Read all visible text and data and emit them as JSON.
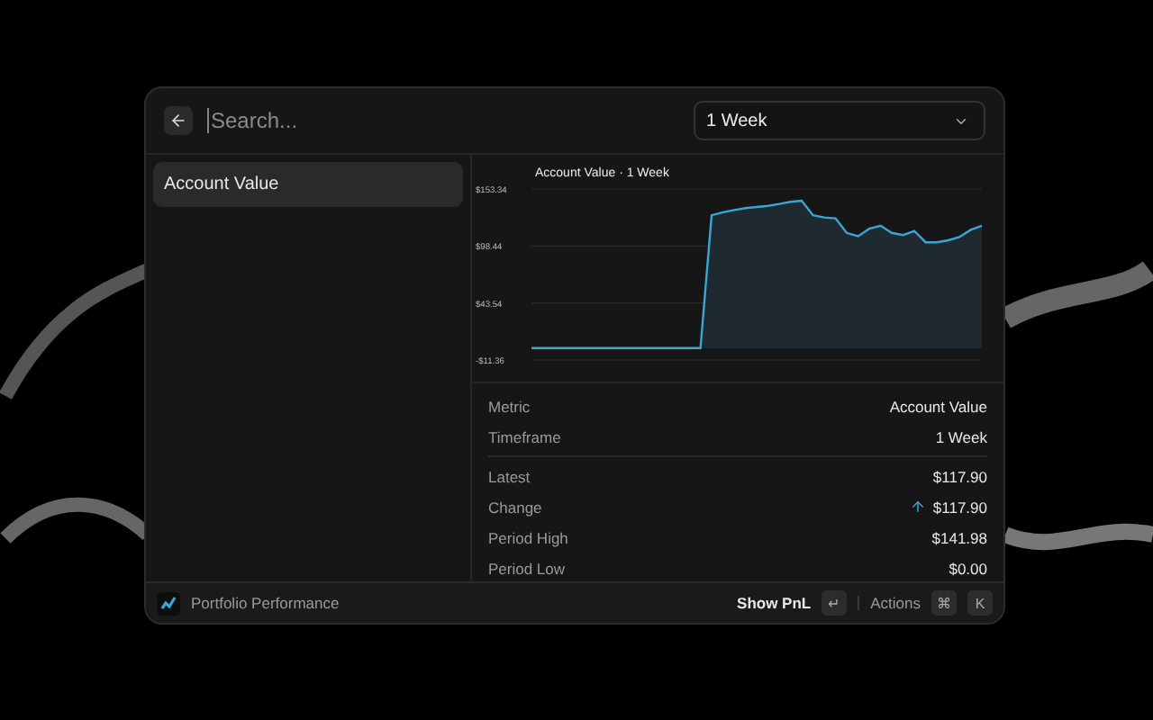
{
  "search": {
    "placeholder": "Search..."
  },
  "timeframe": {
    "value": "1 Week"
  },
  "sidebar": {
    "items": [
      {
        "label": "Account Value",
        "selected": true
      }
    ]
  },
  "chart_data": {
    "type": "area",
    "title": "Account Value · 1 Week",
    "series": [
      {
        "color": "#3aa6d6",
        "values": [
          0,
          0,
          0,
          0,
          0,
          0,
          0,
          0,
          0,
          0,
          0,
          0,
          0,
          0,
          0,
          0,
          128,
          131,
          133,
          135,
          136,
          137,
          139,
          141,
          142,
          128,
          126,
          125,
          111,
          108,
          115,
          118,
          111,
          109,
          113,
          102,
          102,
          104,
          107,
          114,
          118
        ]
      }
    ],
    "ylim": [
      -11.36,
      153.34
    ],
    "yticks": [
      {
        "value": -11.36,
        "label": "-$11.36"
      },
      {
        "value": 43.54,
        "label": "$43.54"
      },
      {
        "value": 98.44,
        "label": "$98.44"
      },
      {
        "value": 153.34,
        "label": "$153.34"
      }
    ]
  },
  "info": [
    {
      "label": "Metric",
      "value": "Account Value"
    },
    {
      "label": "Timeframe",
      "value": "1 Week"
    }
  ],
  "stats": [
    {
      "kind": "plain",
      "label": "Latest",
      "value": "$117.90"
    },
    {
      "kind": "change",
      "label": "Change",
      "value": "$117.90"
    },
    {
      "kind": "plain",
      "label": "Period High",
      "value": "$141.98"
    },
    {
      "kind": "plain",
      "label": "Period Low",
      "value": "$0.00"
    }
  ],
  "footer": {
    "title": "Portfolio Performance",
    "primary_action": "Show PnL",
    "primary_key": "↵",
    "actions_label": "Actions",
    "action_keys": [
      "⌘",
      "K"
    ]
  }
}
